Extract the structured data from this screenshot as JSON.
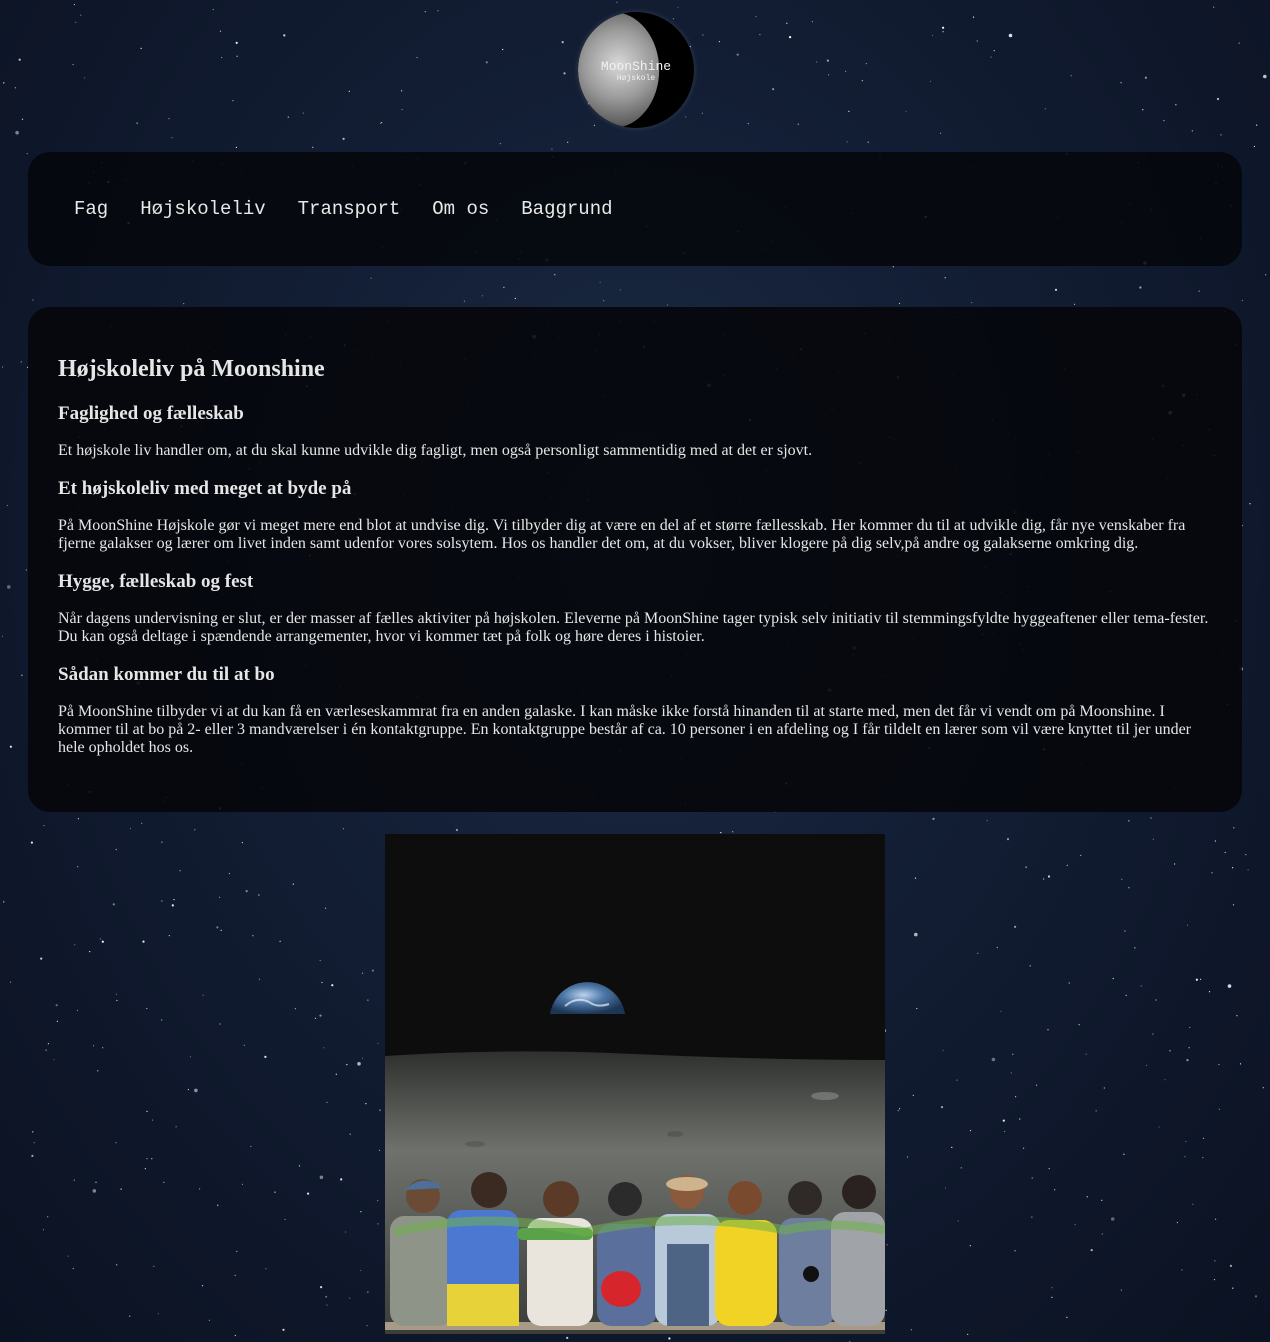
{
  "logo": {
    "name": "MoonShine",
    "sub": "Højskole"
  },
  "nav": {
    "items": [
      "Fag",
      "Højskoleliv",
      "Transport",
      "Om os",
      "Baggrund"
    ]
  },
  "content": {
    "title": "Højskoleliv på Moonshine",
    "sections": [
      {
        "heading": "Faglighed og fælleskab",
        "text": "Et højskole liv handler om, at du skal kunne udvikle dig fagligt, men også personligt sammentidig med at det er sjovt."
      },
      {
        "heading": "Et højskoleliv med meget at byde på",
        "text": "På MoonShine Højskole gør vi meget mere end blot at undvise dig. Vi tilbyder dig at være en del af et større fællesskab. Her kommer du til at udvikle dig, får nye venskaber fra fjerne galakser og lærer om livet inden samt udenfor vores solsytem. Hos os handler det om, at du vokser, bliver klogere på dig selv,på andre og galakserne omkring dig."
      },
      {
        "heading": "Hygge, fælleskab og fest",
        "text": "Når dagens undervisning er slut, er der masser af fælles aktiviter på højskolen. Eleverne på MoonShine tager typisk selv initiativ til stemmingsfyldte hyggeaftener eller tema-fester. Du kan også deltage i spændende arrangementer, hvor vi kommer tæt på folk og høre deres i histoier."
      },
      {
        "heading": "Sådan kommer du til at bo",
        "text": "På MoonShine tilbyder vi at du kan få en værleseskammrat fra en anden galaske. I kan måske ikke forstå hinanden til at starte med, men det får vi vendt om på Moonshine. I kommer til at bo på 2- eller 3 mandværelser i én kontaktgruppe. En kontaktgruppe består af ca. 10 personer i en afdeling og I får tildelt en lærer som vil være knyttet til jer under hele opholdet hos os."
      }
    ]
  }
}
